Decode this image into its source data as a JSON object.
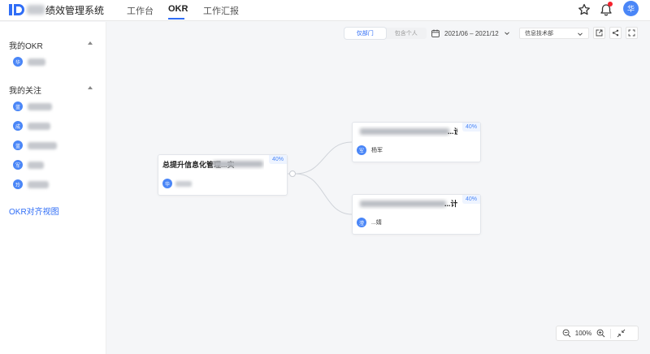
{
  "header": {
    "app_title": "绩效管理系统",
    "tabs": [
      {
        "label": "工作台"
      },
      {
        "label": "OKR"
      },
      {
        "label": "工作汇报"
      }
    ],
    "avatar_text": "华"
  },
  "sidebar": {
    "my_okr_title": "我的OKR",
    "my_okr_avatar": "华",
    "following_title": "我的关注",
    "following": [
      {
        "avatar": "蓝"
      },
      {
        "avatar": "成"
      },
      {
        "avatar": "蓝"
      },
      {
        "avatar": "军"
      },
      {
        "avatar": "玲"
      }
    ],
    "align_view_link": "OKR对齐视图"
  },
  "toolbar": {
    "scope_options": [
      "仅部门",
      "包含个人"
    ],
    "scope_selected": "仅部门",
    "date_range": "2021/06 – 2021/12",
    "department": "信息技术部"
  },
  "cards": [
    {
      "title_visible": "总提升信息化管理...实",
      "progress": "40%",
      "owner_avatar": "华"
    },
    {
      "title_visible": "...设",
      "progress": "40%",
      "owner_avatar": "军",
      "owner_name": "杨军"
    },
    {
      "title_visible": "...计",
      "progress": "40%",
      "owner_avatar": "滢",
      "owner_name": "...婧"
    }
  ],
  "zoom": {
    "level": "100%"
  },
  "colors": {
    "accent": "#2f6df6",
    "avatar": "#4a86f7",
    "notification": "#f5222d"
  }
}
